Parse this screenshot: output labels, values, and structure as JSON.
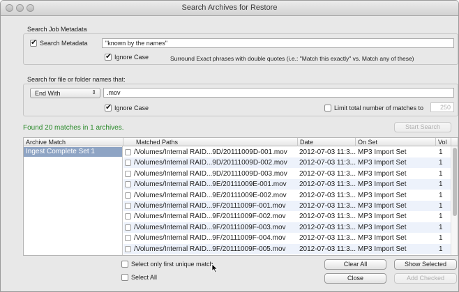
{
  "window": {
    "title": "Search Archives for Restore"
  },
  "job_metadata": {
    "section_label": "Search Job Metadata",
    "search_metadata_label": "Search Metadata",
    "search_metadata_checked": true,
    "query": "\"known by the names\"",
    "ignore_case_label": "Ignore Case",
    "ignore_case_checked": true,
    "hint": "Surround Exact phrases with double quotes (i.e.: \"Match this exactly\" vs. Match any of these)"
  },
  "file_names": {
    "section_label": "Search for file or folder names that:",
    "match_mode": "End With",
    "query": ".mov",
    "ignore_case_label": "Ignore Case",
    "ignore_case_checked": true,
    "limit_label": "Limit total number of matches to",
    "limit_checked": false,
    "limit_value": "250"
  },
  "status": {
    "found_text": "Found 20 matches in 1 archives."
  },
  "buttons": {
    "start_search": "Start Search",
    "clear_all": "Clear All",
    "show_selected": "Show Selected",
    "close": "Close",
    "add_checked": "Add Checked"
  },
  "options": {
    "first_unique_label": "Select only first unique match",
    "select_all_label": "Select All"
  },
  "table": {
    "columns": {
      "archive_match": "Archive Match",
      "matched_paths": "Matched Paths",
      "date": "Date",
      "on_set": "On Set",
      "vol": "Vol"
    },
    "archive": "Ingest Complete Set 1",
    "rows": [
      {
        "path": "/Volumes/Internal RAID...9D/20111009D-001.mov",
        "date": "2012-07-03 11:3...",
        "set": "MP3 Import Set",
        "vol": "1"
      },
      {
        "path": "/Volumes/Internal RAID...9D/20111009D-002.mov",
        "date": "2012-07-03 11:3...",
        "set": "MP3 Import Set",
        "vol": "1"
      },
      {
        "path": "/Volumes/Internal RAID...9D/20111009D-003.mov",
        "date": "2012-07-03 11:3...",
        "set": "MP3 Import Set",
        "vol": "1"
      },
      {
        "path": "/Volumes/Internal RAID...9E/20111009E-001.mov",
        "date": "2012-07-03 11:3...",
        "set": "MP3 Import Set",
        "vol": "1"
      },
      {
        "path": "/Volumes/Internal RAID...9E/20111009E-002.mov",
        "date": "2012-07-03 11:3...",
        "set": "MP3 Import Set",
        "vol": "1"
      },
      {
        "path": "/Volumes/Internal RAID...9F/20111009F-001.mov",
        "date": "2012-07-03 11:3...",
        "set": "MP3 Import Set",
        "vol": "1"
      },
      {
        "path": "/Volumes/Internal RAID...9F/20111009F-002.mov",
        "date": "2012-07-03 11:3...",
        "set": "MP3 Import Set",
        "vol": "1"
      },
      {
        "path": "/Volumes/Internal RAID...9F/20111009F-003.mov",
        "date": "2012-07-03 11:3...",
        "set": "MP3 Import Set",
        "vol": "1"
      },
      {
        "path": "/Volumes/Internal RAID...9F/20111009F-004.mov",
        "date": "2012-07-03 11:3...",
        "set": "MP3 Import Set",
        "vol": "1"
      },
      {
        "path": "/Volumes/Internal RAID...9F/20111009F-005.mov",
        "date": "2012-07-03 11:3...",
        "set": "MP3 Import Set",
        "vol": "1"
      }
    ]
  },
  "colors": {
    "found_text": "#2a8a2a",
    "selection": "#8ea4c4",
    "alt_row": "#edf2fb"
  }
}
